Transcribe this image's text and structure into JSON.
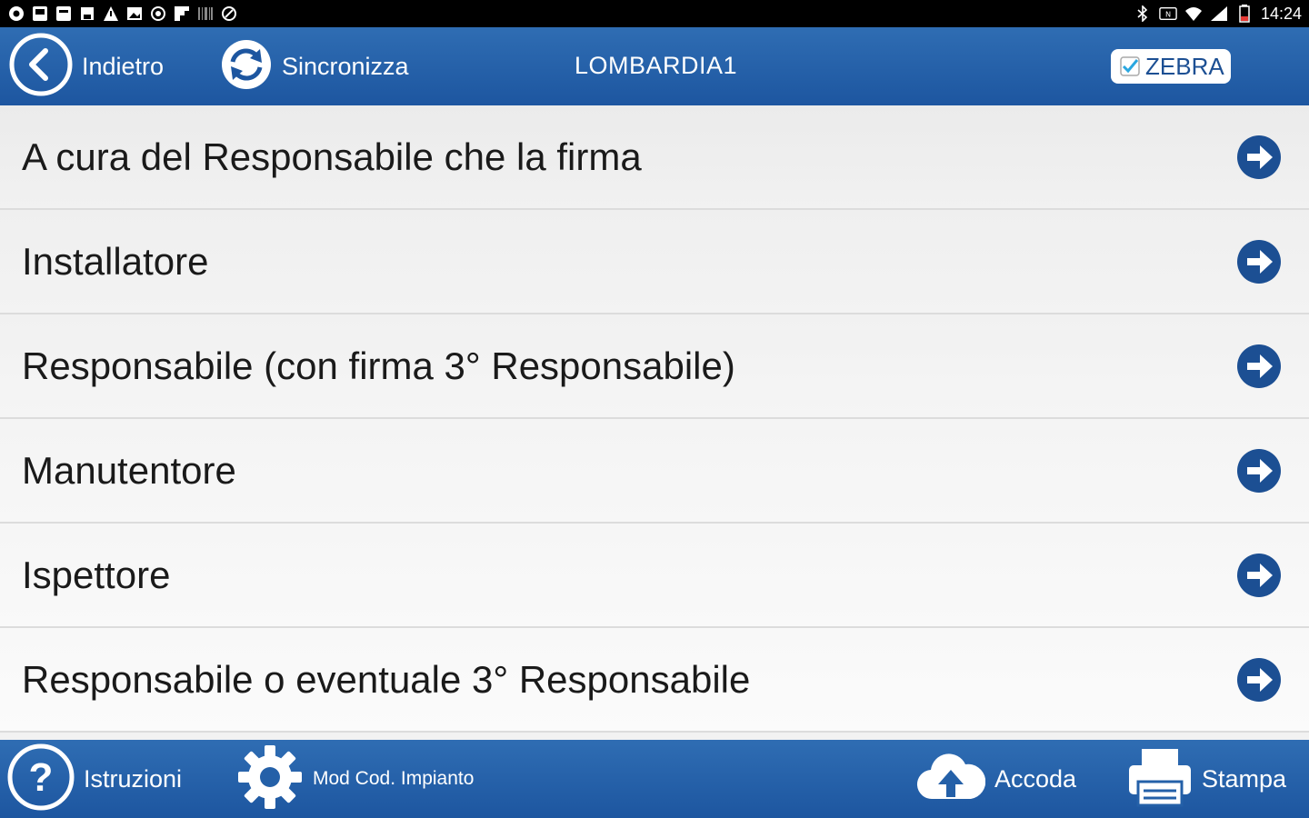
{
  "status_bar": {
    "left_icons": [
      "chrome-icon",
      "app-icon",
      "app-icon",
      "save-icon",
      "warning-icon",
      "image-icon",
      "circle-icon",
      "flipboard-icon",
      "barcode-icon",
      "compass-icon"
    ],
    "right_icons": [
      "bluetooth-icon",
      "nfc-icon",
      "wifi-icon",
      "signal-icon",
      "battery-icon"
    ],
    "time": "14:24"
  },
  "header": {
    "back_label": "Indietro",
    "sync_label": "Sincronizza",
    "title": "LOMBARDIA1",
    "printer_toggle_label": "ZEBRA",
    "printer_toggle_checked": true
  },
  "list": {
    "items": [
      {
        "label": "A cura del Responsabile che la firma"
      },
      {
        "label": "Installatore"
      },
      {
        "label": "Responsabile (con firma 3° Responsabile)"
      },
      {
        "label": "Manutentore"
      },
      {
        "label": "Ispettore"
      },
      {
        "label": "Responsabile o eventuale 3° Responsabile"
      }
    ]
  },
  "footer": {
    "help_label": "Istruzioni",
    "settings_label": "Mod Cod. Impianto",
    "queue_label": "Accoda",
    "print_label": "Stampa"
  },
  "colors": {
    "bar_top": "#2f6db3",
    "bar_bottom": "#1d56a0",
    "arrow_circle": "#1c4f93",
    "list_text": "#1a1a1a"
  }
}
